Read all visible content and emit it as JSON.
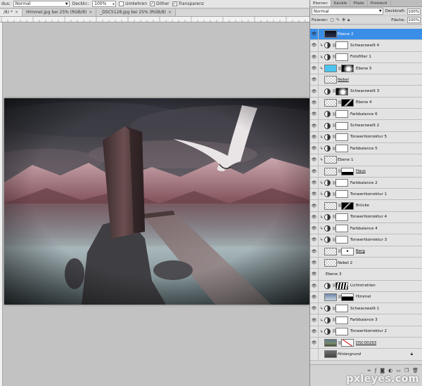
{
  "optionsbar": {
    "mode_label": "dus:",
    "mode_value": "Normal",
    "opacity_label": "Deckkr.:",
    "opacity_value": "100%",
    "reverse_label": "Umkehren",
    "dither_label": "Dither",
    "transparency_label": "Transparenz"
  },
  "tabs": [
    {
      "label": "/8) *"
    },
    {
      "label": "Himmel.jpg bei 25% (RGB/8)"
    },
    {
      "label": "_DSC5128.jpg bei 25% (RGB/8)"
    }
  ],
  "panel": {
    "tabs": [
      "Ebenen",
      "Kanäle",
      "Pfade",
      "Protokoll"
    ],
    "blend_mode": "Normal",
    "opacity_label": "Deckkraft:",
    "opacity_value": "100%",
    "lock_label": "Fixieren:",
    "fill_label": "Fläche:",
    "fill_value": "100%"
  },
  "layers": [
    {
      "name": "Ebene 2",
      "selected": true,
      "thumb": "dark"
    },
    {
      "name": "Schwarzweiß 4",
      "adj": true,
      "clip": true
    },
    {
      "name": "Fotofilter 1",
      "adj": true,
      "clip": true
    },
    {
      "name": "Ebene 5",
      "thumb": "cyan",
      "mask": "glow",
      "clip": true
    },
    {
      "name": "Nebel",
      "thumb": "trans",
      "underline": true
    },
    {
      "name": "Schwarzweiß 3",
      "adj": true,
      "mask": "glow"
    },
    {
      "name": "Ebene 4",
      "thumb": "trans",
      "mask": "bird"
    },
    {
      "name": "Farbbalance 6",
      "adj": true
    },
    {
      "name": "Schwarzweiß 2",
      "adj": true
    },
    {
      "name": "Tonwertkorrektur 5",
      "adj": true,
      "clip": true
    },
    {
      "name": "Farbbalance 5",
      "adj": true,
      "clip": true
    },
    {
      "name": "Ebene 1",
      "thumb": "trans",
      "clip": true
    },
    {
      "name": "Haus",
      "thumb": "trans",
      "mask": "house",
      "underline": true
    },
    {
      "name": "Farbbalance 2",
      "adj": true,
      "clip": true
    },
    {
      "name": "Tonwertkorrektur 1",
      "adj": true,
      "clip": true
    },
    {
      "name": "Brücke",
      "thumb": "trans",
      "mask": "bridge"
    },
    {
      "name": "Tonwertkorrektur 4",
      "adj": true,
      "clip": true
    },
    {
      "name": "Farbbalance 4",
      "adj": true,
      "clip": true
    },
    {
      "name": "Tonwertkorrektur 3",
      "adj": true,
      "clip": true
    },
    {
      "name": "Berg",
      "thumb": "trans",
      "mask": "dot",
      "underline": true
    },
    {
      "name": "Nebel 2",
      "thumb": "trans"
    },
    {
      "name": "Ebene 3",
      "nothumb": true
    },
    {
      "name": "Lichtstrahlen",
      "adj": true,
      "mask": "rays"
    },
    {
      "name": "Himmel",
      "thumb": "sky",
      "mask": "black"
    },
    {
      "name": "Schwarzweiß 1",
      "adj": true,
      "clip": true
    },
    {
      "name": "Farbbalance 3",
      "adj": true,
      "clip": true
    },
    {
      "name": "Tonwertkorrektur 2",
      "adj": true,
      "clip": true
    },
    {
      "name": "DSC00293",
      "thumb": "photo",
      "mask": "cross",
      "underline": true
    },
    {
      "name": "Hintergrund",
      "thumb": "photo2",
      "italic": true,
      "locked": true,
      "hidden": true
    }
  ],
  "watermark": "pxleyes.com",
  "colors": {
    "selection": "#3a8ee8",
    "panel": "#d9d9d9",
    "canvas_bg": "#c2c2c2"
  }
}
